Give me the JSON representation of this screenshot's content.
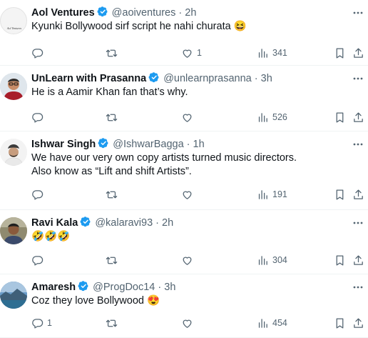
{
  "colors": {
    "verified": "#1d9bf0",
    "text": "#0f1419",
    "secondary": "#536471",
    "divider": "#eff3f4"
  },
  "replies": [
    {
      "name": "Aol Ventures",
      "handle": "@aoiventures",
      "dot": "·",
      "time": "2h",
      "text": "Kyunki Bollywood sirf script he nahi churata 😆",
      "avatar_text": "Aol Ventures",
      "replies": "",
      "retweets": "",
      "likes": "1",
      "views": "341"
    },
    {
      "name": "UnLearn with Prasanna",
      "handle": "@unlearnprasanna",
      "dot": "·",
      "time": "3h",
      "text": "He is a Aamir Khan fan that’s why.",
      "replies": "",
      "retweets": "",
      "likes": "",
      "views": "526"
    },
    {
      "name": "Ishwar Singh",
      "handle": "@IshwarBagga",
      "dot": "·",
      "time": "1h",
      "text": "We have our very own copy artists turned music directors.\nAlso know as “Lift and shift Artists”.",
      "replies": "",
      "retweets": "",
      "likes": "",
      "views": "191"
    },
    {
      "name": "Ravi Kala",
      "handle": "@kalaravi93",
      "dot": "·",
      "time": "2h",
      "text": "🤣🤣🤣",
      "replies": "",
      "retweets": "",
      "likes": "",
      "views": "304"
    },
    {
      "name": "Amaresh",
      "handle": "@ProgDoc14",
      "dot": "·",
      "time": "3h",
      "text": "Coz they love Bollywood 😍",
      "replies": "1",
      "retweets": "",
      "likes": "",
      "views": "454"
    }
  ]
}
